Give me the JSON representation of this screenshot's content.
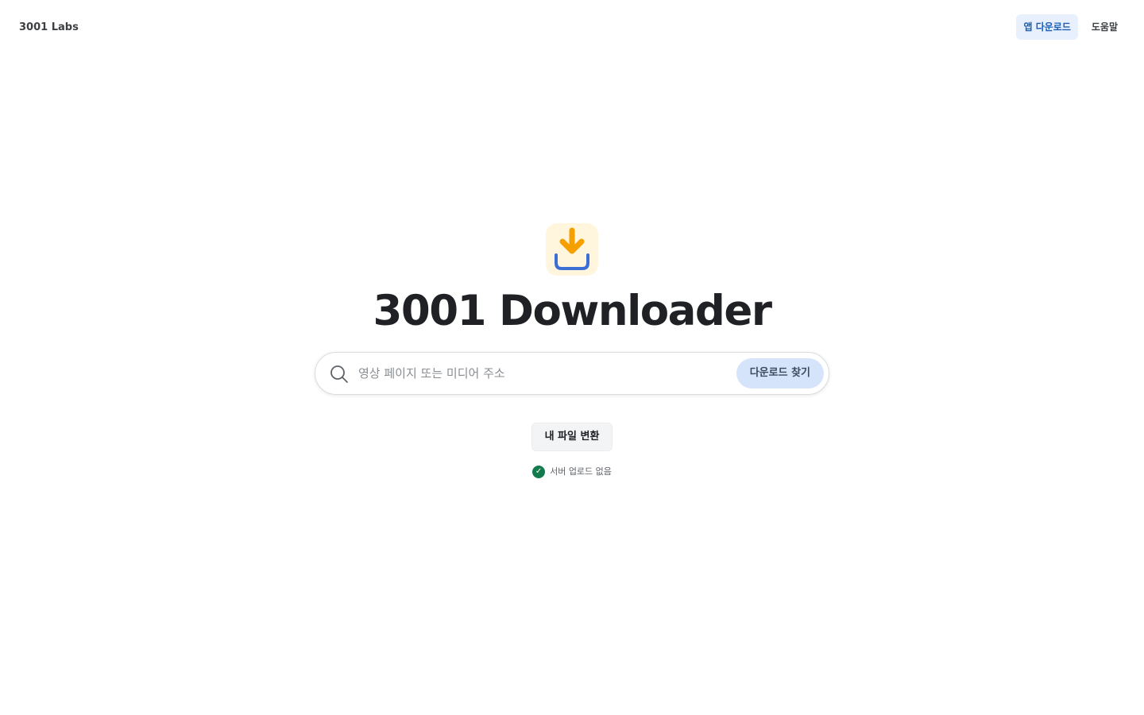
{
  "header": {
    "brand": "3001 Labs",
    "nav": {
      "app_download": "앱 다운로드",
      "help": "도움말"
    }
  },
  "hero": {
    "logo_icon": "download-arrow-icon",
    "title": "3001 Downloader"
  },
  "search": {
    "icon": "search-icon",
    "placeholder": "영상 페이지 또는 미디어 주소",
    "value": "",
    "submit_label": "다운로드 찾기"
  },
  "convert": {
    "label": "내 파일 변환"
  },
  "notice": {
    "icon": "check-circle-icon",
    "text": "서버 업로드 없음"
  },
  "colors": {
    "accent": "#1a5fb4",
    "logo_arrow": "#f5a000",
    "logo_tray": "#3b6fd6",
    "logo_bg": "#fff6dd",
    "success": "#137a4e"
  }
}
